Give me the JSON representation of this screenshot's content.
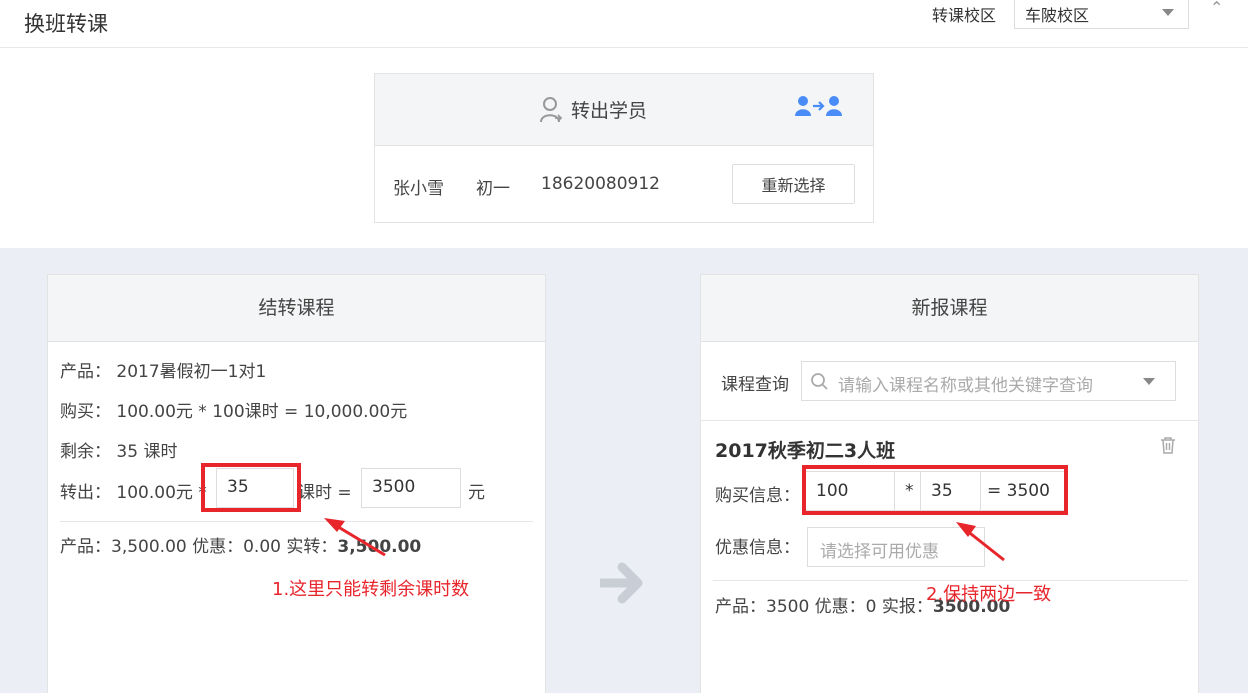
{
  "header": {
    "title": "换班转课",
    "campus_label": "转课校区",
    "campus_value": "车陂校区"
  },
  "student": {
    "title": "转出学员",
    "name": "张小雪",
    "grade": "初一",
    "phone": "18620080912",
    "reselect_label": "重新选择"
  },
  "left": {
    "title": "结转课程",
    "product_line": "产品： 2017暑假初一1对1",
    "purchase_line": "购买： 100.00元 * 100课时 = 10,000.00元",
    "remaining_line": "剩余： 35 课时",
    "transfer_prefix": "转出： 100.00元 *",
    "transfer_hours": "35",
    "transfer_hours_unit": "课时 =",
    "transfer_amount": "3500",
    "transfer_currency": "元",
    "summary_prefix": "产品：3,500.00    优惠：0.00    实转：",
    "summary_value": "3,500.00"
  },
  "right": {
    "title": "新报课程",
    "search_label": "课程查询",
    "search_placeholder": "请输入课程名称或其他关键字查询",
    "course_name": "2017秋季初二3人班",
    "buy_label": "购买信息：",
    "buy_price": "100",
    "buy_times": "*",
    "buy_hours": "35",
    "buy_total": "= 3500",
    "discount_label": "优惠信息：",
    "discount_placeholder": "请选择可用优惠",
    "summary_prefix": "产品：3500    优惠：0    实报：",
    "summary_value": "3500.00"
  },
  "annotations": {
    "note1": "1.这里只能转剩余课时数",
    "note2": "2.保持两边一致"
  },
  "colors": {
    "accent": "#4a8cf7",
    "annotation": "#e8252b",
    "panel_header": "#f3f5f6",
    "background": "#ebeef4"
  }
}
